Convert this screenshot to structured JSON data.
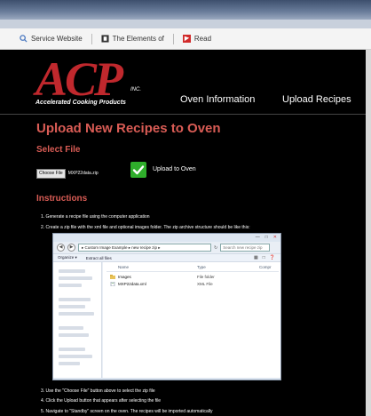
{
  "browser": {
    "bookmarks": [
      {
        "label": "Service Website",
        "icon": "search-icon"
      },
      {
        "label": "The Elements of",
        "icon": "book-icon"
      },
      {
        "label": "Read",
        "icon": "red-flag-icon"
      }
    ]
  },
  "header": {
    "logo_text": "ACP",
    "logo_inc": "INC.",
    "logo_tagline": "Accelerated Cooking Products",
    "nav": [
      "Oven Information",
      "Upload Recipes"
    ]
  },
  "main": {
    "title": "Upload New Recipes to Oven",
    "select_file_heading": "Select File",
    "choose_file_label": "Choose File",
    "chosen_file": "MXP22data.zip",
    "upload_label": "Upload to Oven",
    "instructions_heading": "Instructions",
    "steps": [
      "1. Generate a recipe file using the computer application",
      "2. Create a zip file with the xml file and optional images folder. The zip archive structure should be like this:",
      "3. Use the \"Choose File\" button above to select the zip file",
      "4. Click the Upload button that appears after selecting the file",
      "5. Navigate to \"Standby\" screen on the oven. The recipes will be imported automatically"
    ]
  },
  "explorer": {
    "window_controls": [
      "—",
      "□",
      "✕"
    ],
    "address": "▸ Custom Image Example ▸ new recipe zip ▸",
    "search_placeholder": "Search new recipe zip",
    "toolbar": [
      "Organize ▾",
      "Extract all files"
    ],
    "columns": [
      "Name",
      "Type",
      "Compr"
    ],
    "files": [
      {
        "name": "Images",
        "type": "File folder",
        "icon": "folder-icon"
      },
      {
        "name": "MXP22data.xml",
        "type": "XML File",
        "icon": "xml-file-icon"
      }
    ]
  },
  "colors": {
    "brand_red": "#c0282d",
    "heading_red": "#d95c55",
    "success_green": "#2fae2b"
  }
}
